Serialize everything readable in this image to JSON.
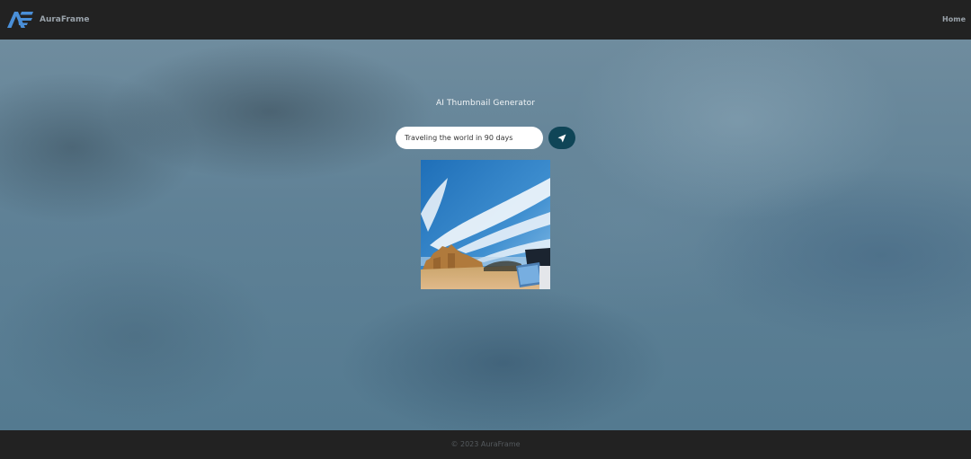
{
  "navbar": {
    "brand_name": "AuraFrame",
    "home_link": "Home",
    "logo_icon": "auraframe-logo-icon"
  },
  "main": {
    "title": "AI Thumbnail Generator",
    "prompt_value": "Traveling the world in 90 days",
    "send_icon": "send-icon",
    "image_icon": "generated-thumbnail-image"
  },
  "footer": {
    "copyright": "© 2023 AuraFrame"
  },
  "colors": {
    "navbar_bg": "#222222",
    "accent_button": "#0f4557",
    "logo_blue": "#4a8fd8"
  }
}
